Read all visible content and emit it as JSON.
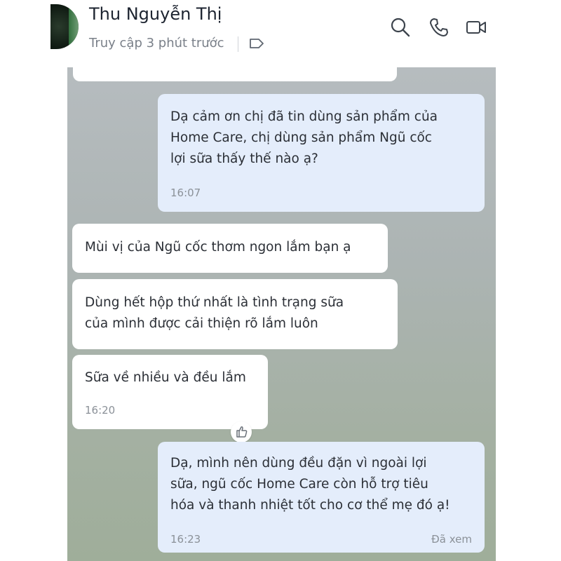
{
  "header": {
    "contact_name": "Thu Nguyễn Thị",
    "status": "Truy cập 3 phút trước",
    "icons": [
      "search-icon",
      "phone-icon",
      "video-call-icon",
      "tag-icon"
    ]
  },
  "messages": [
    {
      "direction": "outgoing",
      "text": "Dạ cảm ơn chị đã tin dùng sản phẩm của\nHome Care, chị dùng sản phẩm Ngũ cốc\nlợi sữa thấy thế nào ạ?",
      "time": "16:07"
    },
    {
      "direction": "incoming",
      "text": "Mùi vị của Ngũ cốc thơm ngon lắm bạn ạ"
    },
    {
      "direction": "incoming",
      "text": "Dùng hết hộp thứ nhất là tình trạng sữa\ncủa mình được cải thiện rõ lắm luôn"
    },
    {
      "direction": "incoming",
      "text": "Sữa về nhiều và đều lắm",
      "time": "16:20",
      "reaction_icon": "thumbs-up-icon"
    },
    {
      "direction": "outgoing",
      "text": "Dạ, mình nên dùng đều đặn vì ngoài lợi\nsữa, ngũ cốc Home Care còn hỗ trợ tiêu\nhóa và thanh nhiệt tốt cho cơ thể mẹ đó ạ!",
      "time": "16:23",
      "seen_label": "Đã xem"
    }
  ],
  "colors": {
    "incoming_bubble": "#ffffff",
    "outgoing_bubble": "#e4edfb",
    "chat_background": "#acb4b3"
  }
}
